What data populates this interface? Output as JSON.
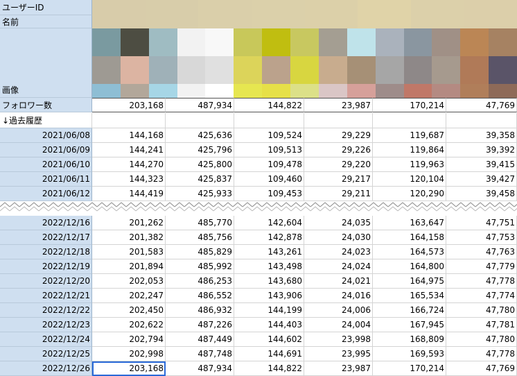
{
  "labels": {
    "user_id": "ユーザーID",
    "name": "名前",
    "image": "画像",
    "followers": "フォロワー数",
    "history": "↓過去履歴"
  },
  "followers_row": [
    "203,168",
    "487,934",
    "144,822",
    "23,987",
    "170,214",
    "47,769"
  ],
  "history_top": [
    {
      "date": "2021/06/08",
      "v": [
        "144,168",
        "425,636",
        "109,524",
        "29,229",
        "119,687",
        "39,358"
      ]
    },
    {
      "date": "2021/06/09",
      "v": [
        "144,241",
        "425,796",
        "109,513",
        "29,226",
        "119,864",
        "39,392"
      ]
    },
    {
      "date": "2021/06/10",
      "v": [
        "144,270",
        "425,800",
        "109,478",
        "29,220",
        "119,963",
        "39,415"
      ]
    },
    {
      "date": "2021/06/11",
      "v": [
        "144,323",
        "425,837",
        "109,460",
        "29,217",
        "120,104",
        "39,427"
      ]
    },
    {
      "date": "2021/06/12",
      "v": [
        "144,419",
        "425,933",
        "109,453",
        "29,211",
        "120,290",
        "39,458"
      ]
    }
  ],
  "history_bottom": [
    {
      "date": "2022/12/16",
      "v": [
        "201,262",
        "485,770",
        "142,604",
        "24,035",
        "163,647",
        "47,751"
      ]
    },
    {
      "date": "2022/12/17",
      "v": [
        "201,382",
        "485,756",
        "142,878",
        "24,030",
        "164,158",
        "47,753"
      ]
    },
    {
      "date": "2022/12/18",
      "v": [
        "201,583",
        "485,829",
        "143,261",
        "24,023",
        "164,573",
        "47,763"
      ]
    },
    {
      "date": "2022/12/19",
      "v": [
        "201,894",
        "485,992",
        "143,498",
        "24,024",
        "164,800",
        "47,779"
      ]
    },
    {
      "date": "2022/12/20",
      "v": [
        "202,053",
        "486,253",
        "143,680",
        "24,021",
        "164,975",
        "47,778"
      ]
    },
    {
      "date": "2022/12/21",
      "v": [
        "202,247",
        "486,552",
        "143,906",
        "24,016",
        "165,534",
        "47,774"
      ]
    },
    {
      "date": "2022/12/22",
      "v": [
        "202,450",
        "486,932",
        "144,199",
        "24,006",
        "166,724",
        "47,780"
      ]
    },
    {
      "date": "2022/12/23",
      "v": [
        "202,622",
        "487,226",
        "144,403",
        "24,004",
        "167,945",
        "47,781"
      ]
    },
    {
      "date": "2022/12/24",
      "v": [
        "202,794",
        "487,449",
        "144,602",
        "23,998",
        "168,809",
        "47,780"
      ]
    },
    {
      "date": "2022/12/25",
      "v": [
        "202,998",
        "487,748",
        "144,691",
        "23,995",
        "169,593",
        "47,778"
      ]
    },
    {
      "date": "2022/12/26",
      "v": [
        "203,168",
        "487,934",
        "144,822",
        "23,987",
        "170,214",
        "47,769"
      ]
    }
  ],
  "mosaic_colors": {
    "id_row": [
      "#d8ccaa",
      "#d8cdaa",
      "#dacfaa",
      "#dbd0aa",
      "#dcd0a9",
      "#e0d3a8",
      "#dcd0aa",
      "#dccfaa"
    ],
    "img_row1": [
      "#7a9aa0",
      "#4d4d42",
      "#9fbcc2",
      "#f2f2f2",
      "#f8f8f8",
      "#c8c85a",
      "#c0be10",
      "#c8c860",
      "#a49e92",
      "#bfe3ea",
      "#aab2bc",
      "#8a96a0",
      "#a09086",
      "#bb8655",
      "#a68262"
    ],
    "img_row2": [
      "#9e9a93",
      "#dcb4a2",
      "#9fb1b8",
      "#d8d8d8",
      "#e0e0e0",
      "#dcd45a",
      "#bba28c",
      "#d8d640",
      "#c8ac8e",
      "#a69076",
      "#a6a6a6",
      "#8e8888",
      "#a69a8e",
      "#b07a58",
      "#5a5468"
    ],
    "img_row3": [
      "#8ebed4",
      "#b2a79a",
      "#a6d6e6",
      "#f2f2f2",
      "#ffffff",
      "#e6e650",
      "#e6e048",
      "#dce088",
      "#dac6c6",
      "#d6a09a",
      "#9e8c8a",
      "#c07868",
      "#b48a82",
      "#b07e5a",
      "#8e6a58"
    ]
  }
}
